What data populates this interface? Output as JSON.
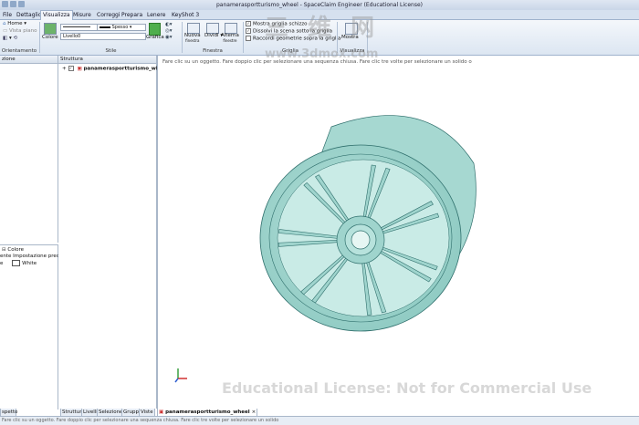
{
  "window": {
    "title": "panamerasportturismo_wheel - SpaceClaim Engineer (Educational License)"
  },
  "ribbon_tabs": [
    "File",
    "Dettaglio",
    "Visualizza",
    "Misure",
    "Correggi",
    "Prepara",
    "Lenere",
    "KeyShot 3"
  ],
  "ribbon_active_tab": "Visualizza",
  "ribbon": {
    "orient": {
      "home": "Home",
      "view_plane": "Vista piano",
      "group_label": "Orientamento"
    },
    "style": {
      "colors_label": "Colore",
      "line_style": "Spesso",
      "layer": "Livello0",
      "graphics_label": "Grafica",
      "group_label": "Stile"
    },
    "window": {
      "new_label": "Nuova",
      "new_sub": "finestra",
      "split_label": "Dividi",
      "alternate_label": "Alterna",
      "alternate_sub": "finestre",
      "group_label": "Finestra"
    },
    "grid": {
      "options": [
        {
          "label": "Mostra griglia schizzo",
          "checked": true
        },
        {
          "label": "Dissolvi la scena sotto la griglia",
          "checked": true
        },
        {
          "label": "Raccordi geometrie sopra la griglia",
          "checked": false
        }
      ],
      "group_label": "Griglia"
    },
    "visualize": {
      "show_label": "Mostra",
      "group_label": "Visualizza"
    }
  },
  "left_top_panel": {
    "header": "zione"
  },
  "left_bottom_panel": {
    "rows": [
      {
        "key": "",
        "value": "Colore"
      },
      {
        "key": "ente",
        "value": "Impostazione predefinita"
      },
      {
        "key": "e",
        "value": "White"
      }
    ],
    "swatch_color": "#ffffff"
  },
  "structure_panel": {
    "header": "Struttura",
    "root_item": "panamerasportturismo_wheel"
  },
  "bottom_tabs_left": [
    "spetto"
  ],
  "bottom_tabs_struct": [
    "Struttura",
    "Livelli",
    "Selezione",
    "Gruppi",
    "Viste"
  ],
  "document_tab": "panamerasportturismo_wheel",
  "viewport": {
    "hint": "Fare clic su un oggetto. Fare doppio clic per selezionare una sequenza chiusa. Fare clic tre volte per selezionare un solido o",
    "license_text": "Educational License: Not for Commercial Use",
    "model_color": "#9fd4cd",
    "edge_color": "#2f6f6c"
  },
  "watermark": {
    "chinese": "三 维 网",
    "url": "www.3dmox.com"
  },
  "status": {
    "text": "Fare clic su un oggetto. Fare doppio clic per selezionare una sequenza chiusa. Fare clic tre volte per selezionare un solido"
  }
}
